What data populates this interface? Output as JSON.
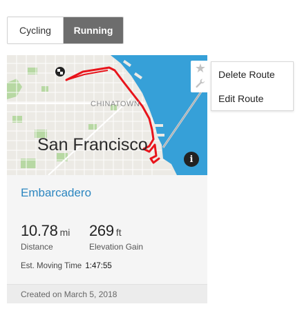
{
  "activity_tabs": [
    {
      "label": "Cycling",
      "selected": false
    },
    {
      "label": "Running",
      "selected": true
    }
  ],
  "map": {
    "city_label": "San Francisco",
    "district_label": "CHINATOWN",
    "info_icon": "info-icon",
    "start_icon": "checkered-flag-icon",
    "route_color": "#e8141b",
    "water_color": "#36a0d8",
    "land_color": "#eceae5"
  },
  "route": {
    "name": "Embarcadero",
    "distance": {
      "value": "10.78",
      "unit": "mi",
      "label": "Distance"
    },
    "elevation": {
      "value": "269",
      "unit": "ft",
      "label": "Elevation Gain"
    },
    "moving_time": {
      "label": "Est. Moving Time",
      "value": "1:47:55"
    },
    "created": "Created on March 5, 2018"
  },
  "route_tools": [
    {
      "name": "star-icon"
    },
    {
      "name": "wrench-icon"
    }
  ],
  "route_menu": {
    "items": [
      "Delete Route",
      "Edit Route"
    ]
  }
}
